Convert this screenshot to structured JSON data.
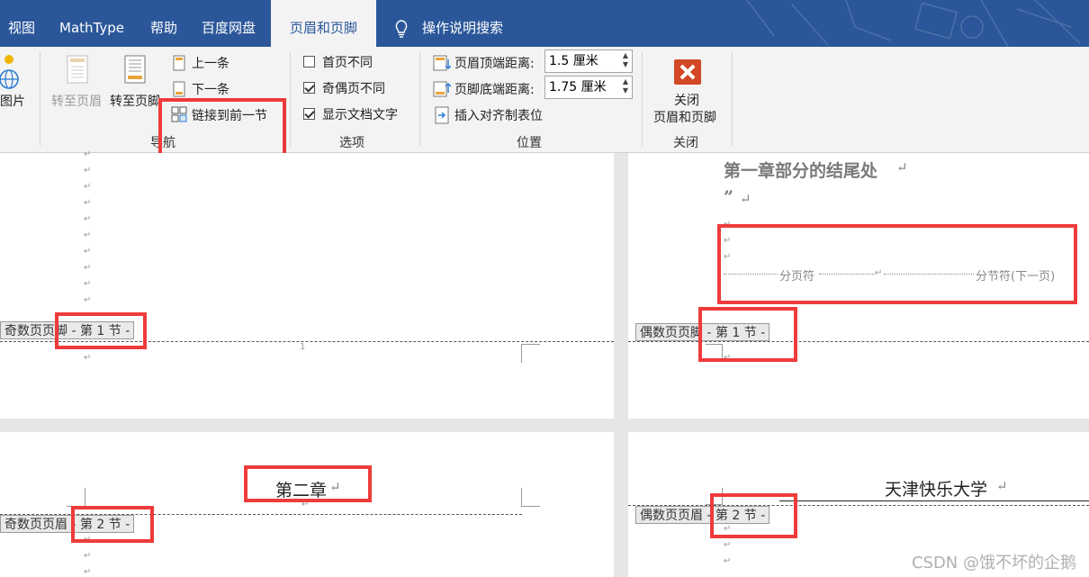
{
  "tabs": {
    "view": "视图",
    "mathtype": "MathType",
    "help": "帮助",
    "baidu": "百度网盘",
    "header_footer": "页眉和页脚",
    "tell_me": "操作说明搜索"
  },
  "ribbon": {
    "picture_label": "图片",
    "goto_header": "转至页眉",
    "goto_footer": "转至页脚",
    "prev": "上一条",
    "next": "下一条",
    "link_prev": "链接到前一节",
    "nav_group": "导航",
    "diff_first": "首页不同",
    "diff_odd_even": "奇偶页不同",
    "show_doc_text": "显示文档文字",
    "options_group": "选项",
    "header_top_label": "页眉顶端距离:",
    "header_top_value": "1.5 厘米",
    "footer_bottom_label": "页脚底端距离:",
    "footer_bottom_value": "1.75 厘米",
    "insert_align_tab": "插入对齐制表位",
    "position_group": "位置",
    "close_line1": "关闭",
    "close_line2": "页眉和页脚",
    "close_group": "关闭"
  },
  "checkboxes": {
    "diff_first": false,
    "diff_odd_even": true,
    "show_doc_text": true
  },
  "doc": {
    "odd_footer_tag": "奇数页页脚 - 第 1 节 -",
    "even_footer_tag": "偶数页页脚 - 第 1 节 -",
    "odd_header_tag": "奇数页页眉 - 第 2 节 -",
    "even_header_tag": "偶数页页眉 - 第 2 节 -",
    "page_number": "1",
    "chapter1_end": "第一章部分的结尾处",
    "quote_mark": "”",
    "page_break": "分页符",
    "section_break": "分节符(下一页)",
    "chapter2": "第二章",
    "university": "天津快乐大学",
    "para_mark": "↵"
  },
  "watermark": "CSDN @饿不坏的企鹅",
  "colors": {
    "ribbon_blue": "#2b579a",
    "highlight_red": "#ef3b3b",
    "close_red": "#d24726"
  }
}
